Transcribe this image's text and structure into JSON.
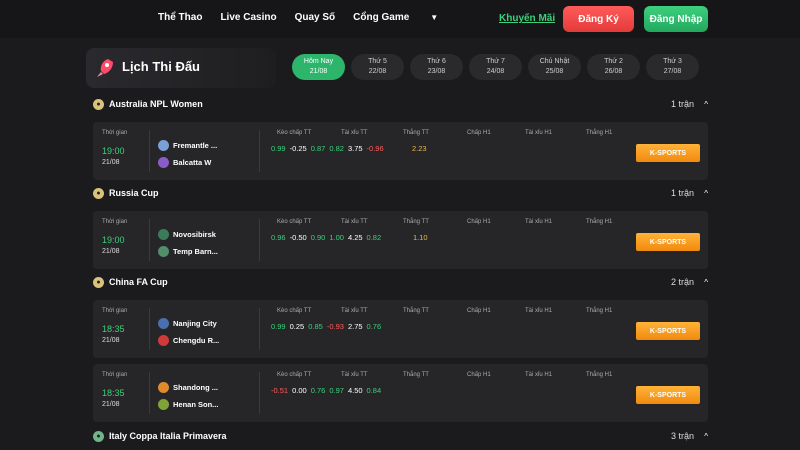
{
  "nav": {
    "items": [
      "Thể Thao",
      "Live Casino",
      "Quay Số",
      "Cổng Game"
    ],
    "promo": "Khuyến Mãi",
    "register": "Đăng Ký",
    "login": "Đăng Nhập"
  },
  "page": {
    "title": "Lịch Thi Đấu"
  },
  "dates": [
    {
      "day": "Hôm Nay",
      "date": "21/08",
      "active": true
    },
    {
      "day": "Thứ 5",
      "date": "22/08"
    },
    {
      "day": "Thứ 6",
      "date": "23/08"
    },
    {
      "day": "Thứ 7",
      "date": "24/08"
    },
    {
      "day": "Chủ Nhật",
      "date": "25/08"
    },
    {
      "day": "Thứ 2",
      "date": "26/08"
    },
    {
      "day": "Thứ 3",
      "date": "27/08"
    }
  ],
  "columns": {
    "time": "Thời gian",
    "handicap": "Kèo chấp TT",
    "overunder": "Tài xỉu TT",
    "win": "Thắng TT",
    "handicap_h1": "Chấp H1",
    "overunder_h1": "Tài xỉu H1",
    "win_h1": "Thắng H1"
  },
  "leagues": [
    {
      "name": "Australia NPL Women",
      "count": "1 trận",
      "matches": [
        {
          "time": "19:00",
          "date": "21/08",
          "home": "Fremantle ...",
          "away": "Balcatta W",
          "odds": [
            "0.99",
            "-0.25",
            "0.87",
            "0.82",
            "3.75",
            "-0.96"
          ],
          "win": "2.23",
          "button": "K-SPORTS"
        }
      ]
    },
    {
      "name": "Russia Cup",
      "count": "1 trận",
      "matches": [
        {
          "time": "19:00",
          "date": "21/08",
          "home": "Novosibirsk",
          "away": "Temp Barn...",
          "odds": [
            "0.96",
            "-0.50",
            "0.90",
            "1.00",
            "4.25",
            "0.82"
          ],
          "win": "1.10",
          "button": "K-SPORTS"
        }
      ]
    },
    {
      "name": "China FA Cup",
      "count": "2 trận",
      "matches": [
        {
          "time": "18:35",
          "date": "21/08",
          "home": "Nanjing City",
          "away": "Chengdu R...",
          "odds": [
            "0.99",
            "0.25",
            "0.85",
            "-0.93",
            "2.75",
            "0.76"
          ],
          "win": "",
          "button": "K-SPORTS"
        },
        {
          "time": "18:35",
          "date": "21/08",
          "home": "Shandong ...",
          "away": "Henan Son...",
          "odds": [
            "-0.51",
            "0.00",
            "0.76",
            "0.97",
            "4.50",
            "0.84"
          ],
          "win": "",
          "button": "K-SPORTS"
        }
      ]
    },
    {
      "name": "Italy Coppa Italia Primavera",
      "count": "3 trận"
    }
  ]
}
